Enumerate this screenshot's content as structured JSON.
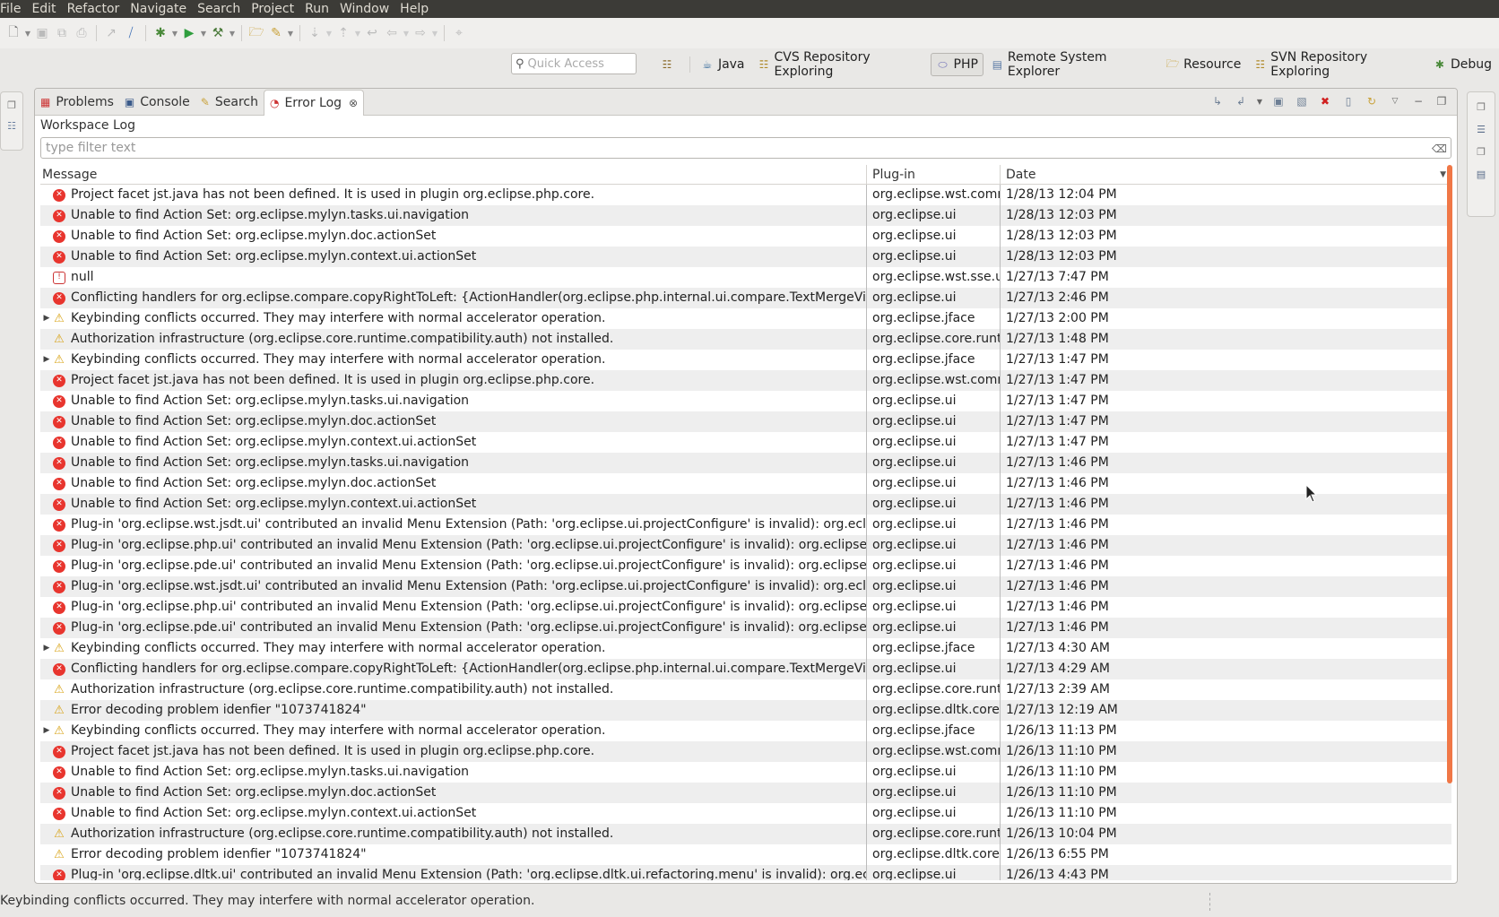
{
  "menu": [
    "File",
    "Edit",
    "Refactor",
    "Navigate",
    "Search",
    "Project",
    "Run",
    "Window",
    "Help"
  ],
  "quick_access": {
    "placeholder": "Quick Access"
  },
  "perspectives": [
    {
      "label": "Java",
      "active": false
    },
    {
      "label": "CVS Repository Exploring",
      "active": false
    },
    {
      "label": "PHP",
      "active": true
    },
    {
      "label": "Remote System Explorer",
      "active": false
    },
    {
      "label": "Resource",
      "active": false
    },
    {
      "label": "SVN Repository Exploring",
      "active": false
    },
    {
      "label": "Debug",
      "active": false
    }
  ],
  "tabs": [
    {
      "label": "Problems",
      "icon": "problems-icon",
      "selected": false
    },
    {
      "label": "Console",
      "icon": "console-icon",
      "selected": false
    },
    {
      "label": "Search",
      "icon": "search-icon",
      "selected": false
    },
    {
      "label": "Error Log",
      "icon": "error-log-icon",
      "selected": true
    }
  ],
  "log": {
    "title": "Workspace Log",
    "filter_placeholder": "type filter text",
    "columns": {
      "message": "Message",
      "plugin": "Plug-in",
      "date": "Date"
    }
  },
  "rows": [
    {
      "type": "error",
      "expandable": false,
      "message": "Project facet jst.java has not been defined. It is used in plugin org.eclipse.php.core.",
      "plugin": "org.eclipse.wst.common.project.facet.core",
      "date": "1/28/13 12:04 PM"
    },
    {
      "type": "error",
      "expandable": false,
      "message": "Unable to find Action Set: org.eclipse.mylyn.tasks.ui.navigation",
      "plugin": "org.eclipse.ui",
      "date": "1/28/13 12:03 PM"
    },
    {
      "type": "error",
      "expandable": false,
      "message": "Unable to find Action Set: org.eclipse.mylyn.doc.actionSet",
      "plugin": "org.eclipse.ui",
      "date": "1/28/13 12:03 PM"
    },
    {
      "type": "error",
      "expandable": false,
      "message": "Unable to find Action Set: org.eclipse.mylyn.context.ui.actionSet",
      "plugin": "org.eclipse.ui",
      "date": "1/28/13 12:03 PM"
    },
    {
      "type": "session",
      "expandable": false,
      "message": "null",
      "plugin": "org.eclipse.wst.sse.ui",
      "date": "1/27/13 7:47 PM"
    },
    {
      "type": "error",
      "expandable": false,
      "message": "Conflicting handlers for org.eclipse.compare.copyRightToLeft: {ActionHandler(org.eclipse.php.internal.ui.compare.TextMergeViewer",
      "plugin": "org.eclipse.ui",
      "date": "1/27/13 2:46 PM"
    },
    {
      "type": "warning",
      "expandable": true,
      "message": "Keybinding conflicts occurred.  They may interfere with normal accelerator operation.",
      "plugin": "org.eclipse.jface",
      "date": "1/27/13 2:00 PM"
    },
    {
      "type": "warning",
      "expandable": false,
      "message": "Authorization infrastructure (org.eclipse.core.runtime.compatibility.auth) not installed.",
      "plugin": "org.eclipse.core.runtime",
      "date": "1/27/13 1:48 PM"
    },
    {
      "type": "warning",
      "expandable": true,
      "message": "Keybinding conflicts occurred.  They may interfere with normal accelerator operation.",
      "plugin": "org.eclipse.jface",
      "date": "1/27/13 1:47 PM"
    },
    {
      "type": "error",
      "expandable": false,
      "message": "Project facet jst.java has not been defined. It is used in plugin org.eclipse.php.core.",
      "plugin": "org.eclipse.wst.common.project.facet.core",
      "date": "1/27/13 1:47 PM"
    },
    {
      "type": "error",
      "expandable": false,
      "message": "Unable to find Action Set: org.eclipse.mylyn.tasks.ui.navigation",
      "plugin": "org.eclipse.ui",
      "date": "1/27/13 1:47 PM"
    },
    {
      "type": "error",
      "expandable": false,
      "message": "Unable to find Action Set: org.eclipse.mylyn.doc.actionSet",
      "plugin": "org.eclipse.ui",
      "date": "1/27/13 1:47 PM"
    },
    {
      "type": "error",
      "expandable": false,
      "message": "Unable to find Action Set: org.eclipse.mylyn.context.ui.actionSet",
      "plugin": "org.eclipse.ui",
      "date": "1/27/13 1:47 PM"
    },
    {
      "type": "error",
      "expandable": false,
      "message": "Unable to find Action Set: org.eclipse.mylyn.tasks.ui.navigation",
      "plugin": "org.eclipse.ui",
      "date": "1/27/13 1:46 PM"
    },
    {
      "type": "error",
      "expandable": false,
      "message": "Unable to find Action Set: org.eclipse.mylyn.doc.actionSet",
      "plugin": "org.eclipse.ui",
      "date": "1/27/13 1:46 PM"
    },
    {
      "type": "error",
      "expandable": false,
      "message": "Unable to find Action Set: org.eclipse.mylyn.context.ui.actionSet",
      "plugin": "org.eclipse.ui",
      "date": "1/27/13 1:46 PM"
    },
    {
      "type": "error",
      "expandable": false,
      "message": "Plug-in 'org.eclipse.wst.jsdt.ui' contributed an invalid Menu Extension (Path: 'org.eclipse.ui.projectConfigure' is invalid): org.eclipse.ws",
      "plugin": "org.eclipse.ui",
      "date": "1/27/13 1:46 PM"
    },
    {
      "type": "error",
      "expandable": false,
      "message": "Plug-in 'org.eclipse.php.ui' contributed an invalid Menu Extension (Path: 'org.eclipse.ui.projectConfigure' is invalid): org.eclipse.php.in",
      "plugin": "org.eclipse.ui",
      "date": "1/27/13 1:46 PM"
    },
    {
      "type": "error",
      "expandable": false,
      "message": "Plug-in 'org.eclipse.pde.ui' contributed an invalid Menu Extension (Path: 'org.eclipse.ui.projectConfigure' is invalid): org.eclipse.pde.ui",
      "plugin": "org.eclipse.ui",
      "date": "1/27/13 1:46 PM"
    },
    {
      "type": "error",
      "expandable": false,
      "message": "Plug-in 'org.eclipse.wst.jsdt.ui' contributed an invalid Menu Extension (Path: 'org.eclipse.ui.projectConfigure' is invalid): org.eclipse.ws",
      "plugin": "org.eclipse.ui",
      "date": "1/27/13 1:46 PM"
    },
    {
      "type": "error",
      "expandable": false,
      "message": "Plug-in 'org.eclipse.php.ui' contributed an invalid Menu Extension (Path: 'org.eclipse.ui.projectConfigure' is invalid): org.eclipse.php.in",
      "plugin": "org.eclipse.ui",
      "date": "1/27/13 1:46 PM"
    },
    {
      "type": "error",
      "expandable": false,
      "message": "Plug-in 'org.eclipse.pde.ui' contributed an invalid Menu Extension (Path: 'org.eclipse.ui.projectConfigure' is invalid): org.eclipse.pde.ui",
      "plugin": "org.eclipse.ui",
      "date": "1/27/13 1:46 PM"
    },
    {
      "type": "warning",
      "expandable": true,
      "message": "Keybinding conflicts occurred.  They may interfere with normal accelerator operation.",
      "plugin": "org.eclipse.jface",
      "date": "1/27/13 4:30 AM"
    },
    {
      "type": "error",
      "expandable": false,
      "message": "Conflicting handlers for org.eclipse.compare.copyRightToLeft: {ActionHandler(org.eclipse.php.internal.ui.compare.TextMergeViewer",
      "plugin": "org.eclipse.ui",
      "date": "1/27/13 4:29 AM"
    },
    {
      "type": "warning",
      "expandable": false,
      "message": "Authorization infrastructure (org.eclipse.core.runtime.compatibility.auth) not installed.",
      "plugin": "org.eclipse.core.runtime",
      "date": "1/27/13 2:39 AM"
    },
    {
      "type": "warning",
      "expandable": false,
      "message": "Error decoding problem idenfier \"1073741824\"",
      "plugin": "org.eclipse.dltk.core",
      "date": "1/27/13 12:19 AM"
    },
    {
      "type": "warning",
      "expandable": true,
      "message": "Keybinding conflicts occurred.  They may interfere with normal accelerator operation.",
      "plugin": "org.eclipse.jface",
      "date": "1/26/13 11:13 PM"
    },
    {
      "type": "error",
      "expandable": false,
      "message": "Project facet jst.java has not been defined. It is used in plugin org.eclipse.php.core.",
      "plugin": "org.eclipse.wst.common.project.facet.core",
      "date": "1/26/13 11:10 PM"
    },
    {
      "type": "error",
      "expandable": false,
      "message": "Unable to find Action Set: org.eclipse.mylyn.tasks.ui.navigation",
      "plugin": "org.eclipse.ui",
      "date": "1/26/13 11:10 PM"
    },
    {
      "type": "error",
      "expandable": false,
      "message": "Unable to find Action Set: org.eclipse.mylyn.doc.actionSet",
      "plugin": "org.eclipse.ui",
      "date": "1/26/13 11:10 PM"
    },
    {
      "type": "error",
      "expandable": false,
      "message": "Unable to find Action Set: org.eclipse.mylyn.context.ui.actionSet",
      "plugin": "org.eclipse.ui",
      "date": "1/26/13 11:10 PM"
    },
    {
      "type": "warning",
      "expandable": false,
      "message": "Authorization infrastructure (org.eclipse.core.runtime.compatibility.auth) not installed.",
      "plugin": "org.eclipse.core.runtime",
      "date": "1/26/13 10:04 PM"
    },
    {
      "type": "warning",
      "expandable": false,
      "message": "Error decoding problem idenfier \"1073741824\"",
      "plugin": "org.eclipse.dltk.core",
      "date": "1/26/13 6:55 PM"
    },
    {
      "type": "error",
      "expandable": false,
      "message": "Plug-in 'org.eclipse.dltk.ui' contributed an invalid Menu Extension (Path: 'org.eclipse.dltk.ui.refactoring.menu' is invalid): org.eclipse.d",
      "plugin": "org.eclipse.ui",
      "date": "1/26/13 4:43 PM"
    }
  ],
  "status": {
    "text": "Keybinding conflicts occurred.  They may interfere with normal accelerator operation."
  },
  "colors": {
    "menubar": "#3c3b37",
    "error": "#e8352e",
    "warning": "#d8a316",
    "scroll_accent": "#f07746"
  }
}
